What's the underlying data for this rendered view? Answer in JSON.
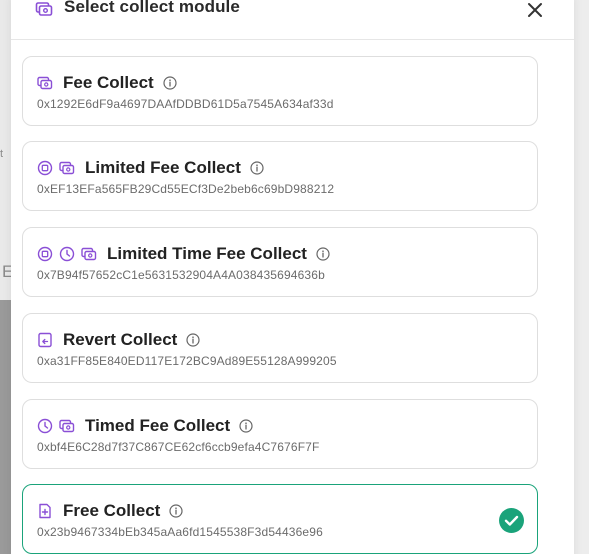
{
  "background": {
    "letters": [
      "t",
      "E"
    ]
  },
  "modal": {
    "title": "Select collect module",
    "header_icon": "collect-module-icon",
    "close_icon": "close-icon"
  },
  "modules": [
    {
      "name": "Fee Collect",
      "address": "0x1292E6dF9a4697DAAfDDBD61D5a7545A634af33d",
      "icons": [
        "money-icon"
      ],
      "selected": false
    },
    {
      "name": "Limited Fee Collect",
      "address": "0xEF13EFa565FB29Cd55ECf3De2beb6c69bD988212",
      "icons": [
        "limit-icon",
        "money-icon"
      ],
      "selected": false
    },
    {
      "name": "Limited Time Fee Collect",
      "address": "0x7B94f57652cC1e5631532904A4A038435694636b",
      "icons": [
        "limit-icon",
        "clock-icon",
        "money-icon"
      ],
      "selected": false
    },
    {
      "name": "Revert Collect",
      "address": "0xa31FF85E840ED117E172BC9Ad89E55128A999205",
      "icons": [
        "revert-icon"
      ],
      "selected": false
    },
    {
      "name": "Timed Fee Collect",
      "address": "0xbf4E6C28d7f37C867CE62cf6ccb9efa4C7676F7F",
      "icons": [
        "clock-icon",
        "money-icon"
      ],
      "selected": false
    },
    {
      "name": "Free Collect",
      "address": "0x23b9467334bEb345aAa6fd1545538F3d54436e96",
      "icons": [
        "free-document-icon"
      ],
      "selected": true
    }
  ],
  "colors": {
    "icon_purple": "#8a4fd6",
    "selected_green": "#1aa37a",
    "info_grey": "#666666"
  }
}
